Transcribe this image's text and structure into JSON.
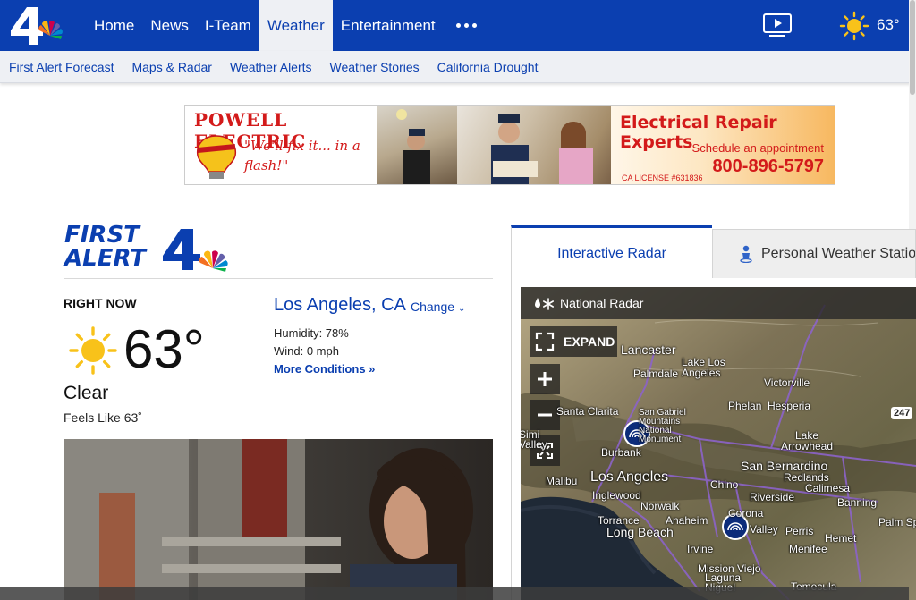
{
  "header": {
    "nav": [
      "Home",
      "News",
      "I-Team",
      "Weather",
      "Entertainment"
    ],
    "active_nav": "Weather",
    "temp": "63°",
    "icons": [
      "nbc4-logo",
      "more-icon",
      "video-icon",
      "sun-icon"
    ]
  },
  "subnav": [
    "First Alert Forecast",
    "Maps & Radar",
    "Weather Alerts",
    "Weather Stories",
    "California Drought"
  ],
  "ad": {
    "brand": "POWELL ELECTRIC",
    "slogan": "\"We'll fix it... in a flash!\"",
    "bulb_text": "POWELL ELECTRIC",
    "headline": "Electrical Repair Experts",
    "sub": "Schedule an appointment",
    "phone": "800-896-5797",
    "license": "CA LICENSE #631836"
  },
  "current": {
    "logo_line1": "FIRST",
    "logo_line2": "ALERT",
    "right_now": "RIGHT NOW",
    "temp": "63°",
    "condition": "Clear",
    "feels_like": "Feels Like 63˚",
    "city": "Los Angeles, CA",
    "change": "Change",
    "humidity": "Humidity: 78%",
    "wind": "Wind: 0 mph",
    "more": "More Conditions »"
  },
  "radar": {
    "tabs": [
      "Interactive Radar",
      "Personal Weather Station"
    ],
    "header": "National Radar",
    "expand": "EXPAND",
    "places": {
      "lancaster": "Lancaster",
      "lake_los_angeles": "Lake Los Angeles",
      "palmdale": "Palmdale",
      "victorville": "Victorville",
      "santa_clarita": "Santa Clarita",
      "san_gabriel": "San Gabriel Mountains National Monument",
      "phelan": "Phelan",
      "hesperia": "Hesperia",
      "simi_valley": "Simi Valley",
      "burbank": "Burbank",
      "lake_arrowhead": "Lake Arrowhead",
      "malibu": "Malibu",
      "los_angeles": "Los Angeles",
      "san_bernardino": "San Bernardino",
      "redlands": "Redlands",
      "inglewood": "Inglewood",
      "chino": "Chino",
      "riverside": "Riverside",
      "calimesa": "Calimesa",
      "norwalk": "Norwalk",
      "corona": "Corona",
      "banning": "Banning",
      "torrance": "Torrance",
      "anaheim": "Anaheim",
      "long_beach": "Long Beach",
      "menifee": "Menifee",
      "perris": "Perris",
      "hemet": "Hemet",
      "irvine": "Irvine",
      "mission_viejo": "Mission Viejo",
      "laguna": "Laguna Niguel",
      "temecula": "Temecula",
      "palm_springs": "Palm Sp",
      "menifee_valley": "Valley",
      "highway": "247"
    }
  },
  "colors": {
    "brand_blue": "#0b3fb0",
    "sun": "#f8c21a",
    "ad_red": "#d31a1a"
  }
}
